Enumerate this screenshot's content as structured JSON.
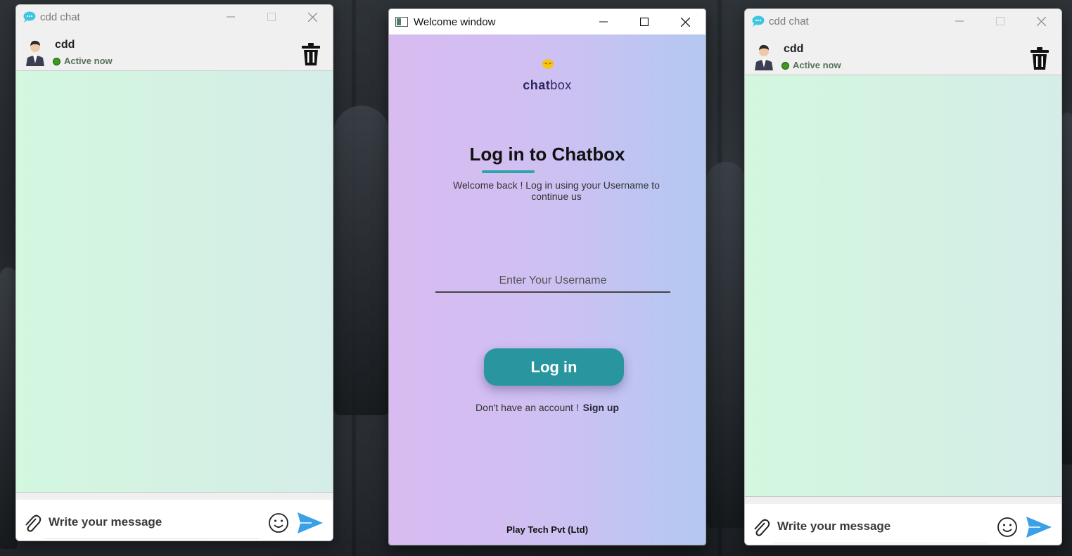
{
  "chat_windows": [
    {
      "title": "cdd chat",
      "contact": {
        "name": "cdd",
        "status": "Active now",
        "status_color": "#3c9a1c"
      },
      "composer": {
        "placeholder": "Write your message"
      }
    },
    {
      "title": "cdd chat",
      "contact": {
        "name": "cdd",
        "status": "Active now",
        "status_color": "#3c9a1c"
      },
      "composer": {
        "placeholder": "Write your message"
      }
    }
  ],
  "welcome_window": {
    "title": "Welcome window",
    "brand": {
      "bold": "chat",
      "light": "box"
    },
    "heading": {
      "emphasis": "Log in",
      "rest": " to Chatbox"
    },
    "subtitle": "Welcome back ! Log in using your Username to continue us",
    "username_placeholder": "Enter Your Username",
    "login_label": "Log in",
    "signup_prompt": "Don't have an account !",
    "signup_link": "Sign up",
    "footer": "Play Tech Pvt (Ltd)"
  },
  "colors": {
    "accent_teal": "#28959f",
    "heading_underline": "#2da4a7",
    "chat_bg": "#d3f7df",
    "send_blue": "#3aa0e8"
  },
  "icons": [
    "chat-bubble-icon",
    "minimize-icon",
    "maximize-icon",
    "close-icon",
    "avatar",
    "trash-icon",
    "paperclip-icon",
    "smiley-icon",
    "send-icon",
    "window-icon",
    "chatbox-logo-icon"
  ]
}
